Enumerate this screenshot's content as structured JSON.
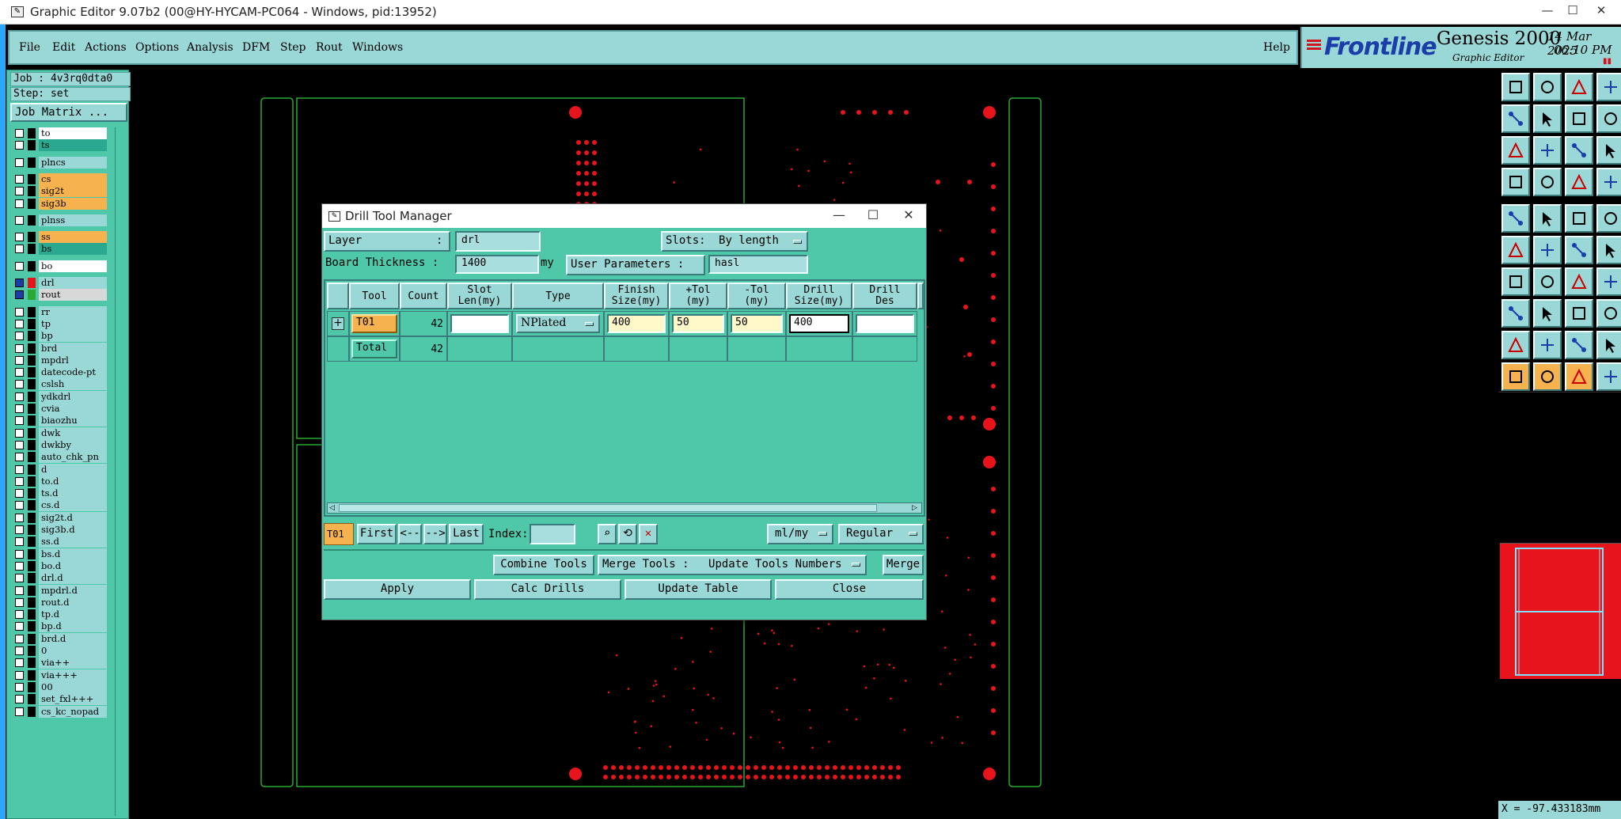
{
  "window": {
    "title": "Graphic Editor 9.07b2 (00@HY-HYCAM-PC064 - Windows, pid:13952)",
    "min": "—",
    "max": "☐",
    "close": "✕"
  },
  "menu": {
    "items": [
      "File",
      "Edit",
      "Actions",
      "Options",
      "Analysis",
      "DFM",
      "Step",
      "Rout",
      "Windows"
    ],
    "help": "Help"
  },
  "brand": {
    "logo": "Frontline",
    "product": "Genesis 2000",
    "subtitle": "Graphic Editor",
    "date": "14 Mar 2025",
    "time": "06:10 PM",
    "pause": "▮▮"
  },
  "job": {
    "job_line": "Job : 4v3rq0dta0",
    "step_line": "Step: set",
    "matrix_button": "Job Matrix ..."
  },
  "layers": [
    {
      "name": "to",
      "bg": "#ffffff",
      "sw": "#000000"
    },
    {
      "name": "ts",
      "bg": "#2aa890",
      "sw": "#000000"
    },
    {
      "name": "plncs",
      "bg": "#9ad7d7",
      "sw": "#000000"
    },
    {
      "name": "cs",
      "bg": "#f5b24e",
      "sw": "#000000"
    },
    {
      "name": "sig2t",
      "bg": "#f5b24e",
      "sw": "#000000"
    },
    {
      "name": "sig3b",
      "bg": "#f5b24e",
      "sw": "#000000"
    },
    {
      "name": "plnss",
      "bg": "#9ad7d7",
      "sw": "#000000"
    },
    {
      "name": "ss",
      "bg": "#f5b24e",
      "sw": "#000000"
    },
    {
      "name": "bs",
      "bg": "#2aa890",
      "sw": "#000000"
    },
    {
      "name": "bo",
      "bg": "#ffffff",
      "sw": "#000000"
    },
    {
      "name": "drl",
      "bg": "#9ad7d7",
      "sw": "#e8141c"
    },
    {
      "name": "rout",
      "bg": "#d8d8d8",
      "sw": "#2aa830"
    },
    {
      "name": "rr",
      "bg": "#9ad7d7",
      "sw": "#000000"
    },
    {
      "name": "tp",
      "bg": "#9ad7d7",
      "sw": "#000000"
    },
    {
      "name": "bp",
      "bg": "#9ad7d7",
      "sw": "#000000"
    },
    {
      "name": "brd",
      "bg": "#9ad7d7",
      "sw": "#000000"
    },
    {
      "name": "mpdrl",
      "bg": "#9ad7d7",
      "sw": "#000000"
    },
    {
      "name": "datecode-pt",
      "bg": "#9ad7d7",
      "sw": "#000000"
    },
    {
      "name": "cslsh",
      "bg": "#9ad7d7",
      "sw": "#000000"
    },
    {
      "name": "ydkdrl",
      "bg": "#9ad7d7",
      "sw": "#000000"
    },
    {
      "name": "cvia",
      "bg": "#9ad7d7",
      "sw": "#000000"
    },
    {
      "name": "biaozhu",
      "bg": "#9ad7d7",
      "sw": "#000000"
    },
    {
      "name": "dwk",
      "bg": "#9ad7d7",
      "sw": "#000000"
    },
    {
      "name": "dwkby",
      "bg": "#9ad7d7",
      "sw": "#000000"
    },
    {
      "name": "auto_chk_pn",
      "bg": "#9ad7d7",
      "sw": "#000000"
    },
    {
      "name": "d",
      "bg": "#9ad7d7",
      "sw": "#000000"
    },
    {
      "name": "to.d",
      "bg": "#9ad7d7",
      "sw": "#000000"
    },
    {
      "name": "ts.d",
      "bg": "#9ad7d7",
      "sw": "#000000"
    },
    {
      "name": "cs.d",
      "bg": "#9ad7d7",
      "sw": "#000000"
    },
    {
      "name": "sig2t.d",
      "bg": "#9ad7d7",
      "sw": "#000000"
    },
    {
      "name": "sig3b.d",
      "bg": "#9ad7d7",
      "sw": "#000000"
    },
    {
      "name": "ss.d",
      "bg": "#9ad7d7",
      "sw": "#000000"
    },
    {
      "name": "bs.d",
      "bg": "#9ad7d7",
      "sw": "#000000"
    },
    {
      "name": "bo.d",
      "bg": "#9ad7d7",
      "sw": "#000000"
    },
    {
      "name": "drl.d",
      "bg": "#9ad7d7",
      "sw": "#000000"
    },
    {
      "name": "mpdrl.d",
      "bg": "#9ad7d7",
      "sw": "#000000"
    },
    {
      "name": "rout.d",
      "bg": "#9ad7d7",
      "sw": "#000000"
    },
    {
      "name": "tp.d",
      "bg": "#9ad7d7",
      "sw": "#000000"
    },
    {
      "name": "bp.d",
      "bg": "#9ad7d7",
      "sw": "#000000"
    },
    {
      "name": "brd.d",
      "bg": "#9ad7d7",
      "sw": "#000000"
    },
    {
      "name": "0",
      "bg": "#9ad7d7",
      "sw": "#000000"
    },
    {
      "name": "via++",
      "bg": "#9ad7d7",
      "sw": "#000000"
    },
    {
      "name": "via+++",
      "bg": "#9ad7d7",
      "sw": "#000000"
    },
    {
      "name": "00",
      "bg": "#9ad7d7",
      "sw": "#000000"
    },
    {
      "name": "set_fxl+++",
      "bg": "#9ad7d7",
      "sw": "#000000"
    },
    {
      "name": "cs_kc_nopad",
      "bg": "#9ad7d7",
      "sw": "#000000"
    }
  ],
  "dialog": {
    "title": "Drill Tool Manager",
    "min": "—",
    "max": "☐",
    "close": "✕",
    "layer_label": "Layer",
    "layer_colon": ":",
    "layer_value": "drl",
    "slots_label": "Slots:",
    "slots_value": "By length",
    "thickness_label": "Board Thickness :",
    "thickness_value": "1400",
    "thickness_unit": "my",
    "user_params_label": "User Parameters :",
    "user_params_value": "hasl",
    "columns": [
      {
        "l1": "Tool",
        "l2": ""
      },
      {
        "l1": "Count",
        "l2": ""
      },
      {
        "l1": "Slot",
        "l2": "Len(my)"
      },
      {
        "l1": "Type",
        "l2": ""
      },
      {
        "l1": "Finish",
        "l2": "Size(my)"
      },
      {
        "l1": "+Tol",
        "l2": "(my)"
      },
      {
        "l1": "-Tol",
        "l2": "(my)"
      },
      {
        "l1": "Drill",
        "l2": "Size(my)"
      },
      {
        "l1": "Drill",
        "l2": "Des"
      }
    ],
    "row": {
      "expander": "+",
      "tool": "T01",
      "count": "42",
      "slot_len": "",
      "type": "NPlated",
      "finish": "400",
      "plus_tol": "50",
      "minus_tol": "50",
      "drill_size": "400",
      "drill_des": ""
    },
    "total_label": "Total",
    "total_count": "42",
    "nav": {
      "current": "T01",
      "first": "First",
      "prev": "<--",
      "next": "-->",
      "last": "Last",
      "index_label": "Index:",
      "index_value": "",
      "units": "ml/my",
      "mode": "Regular"
    },
    "combine_tools": "Combine Tools",
    "merge_tools_label": "Merge Tools :",
    "merge_option": "Update Tools Numbers",
    "merge": "Merge",
    "apply": "Apply",
    "calc_drills": "Calc Drills",
    "update_table": "Update Table",
    "close_btn": "Close"
  },
  "coords": "X = -97.433183mm",
  "colors": {
    "panel": "#4fc8aa",
    "menu": "#9ad7d7",
    "accent_orange": "#f5b24e",
    "drill_red": "#e8141c",
    "board_outline": "#2aa830"
  },
  "toolbar_icons": [
    "zoom-home-icon",
    "zoom-in-icon",
    "zoom-out-icon",
    "window-icon",
    "pan-left-icon",
    "pan-right-icon",
    "redraw-icon",
    "split-icon",
    "fit-icon",
    "center-icon",
    "ratio-icon",
    "help-icon",
    "snap-icon",
    "measure-icon",
    "rout-icon",
    "layers-icon",
    "select-icon",
    "copy-icon",
    "line-icon",
    "pad-icon",
    "connect-icon",
    "cross-icon",
    "move-icon",
    "rotate-icon",
    "edit-icon",
    "draw-icon",
    "arc-icon",
    "text-icon",
    "resize-icon",
    "cut-icon",
    "grid-icon",
    "group-icon",
    "triangle-icon",
    "triangle-up-icon",
    "triangle-a-icon",
    "shape-icon",
    "pointer-icon",
    "pointer-active-icon",
    "pointer-alt-icon",
    "step-icon"
  ]
}
